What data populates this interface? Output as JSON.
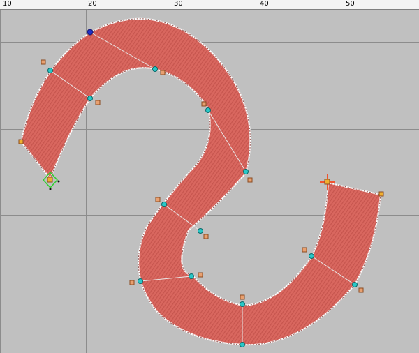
{
  "ruler": {
    "labels": [
      "10",
      "20",
      "30",
      "40",
      "50"
    ]
  },
  "colors": {
    "background": "#c0c0c0",
    "grid_line": "#8c8c8c",
    "stitch_fill": "#d9675f",
    "stitch_dark": "#b5473f",
    "stitch_edge": "#7a2a25",
    "outline": "#ffffff",
    "node_cyan": "#28c8c8",
    "handle_orange": "#e8a070",
    "node_blue": "#2030c8",
    "corner_yellow": "#f0b030",
    "selection_green": "#30d030",
    "crosshair_red": "#ff3000"
  },
  "icons": {
    "start_marker": "green-diamond-start-icon",
    "end_marker": "red-crosshair-end-icon"
  }
}
